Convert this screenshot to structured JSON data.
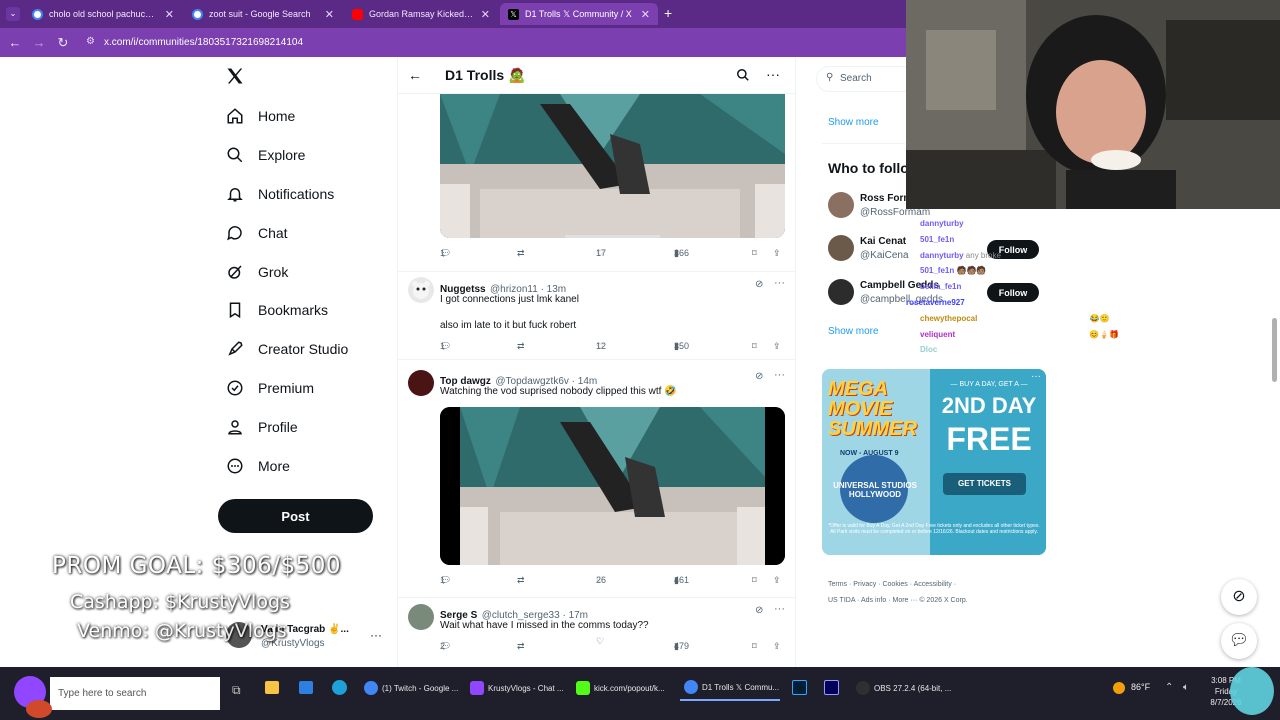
{
  "browser": {
    "tabs": [
      {
        "title": "cholo old school pachuco style",
        "favicon_color": "#4285f4",
        "active": false
      },
      {
        "title": "zoot suit - Google Search",
        "favicon_color": "#4285f4",
        "active": false
      },
      {
        "title": "Gordan Ramsay Kicked Me Out",
        "favicon_color": "#ff0000",
        "active": false
      },
      {
        "title": "D1 Trolls 𝕏 Community / X",
        "favicon_color": "#000000",
        "active": true
      }
    ],
    "url": "x.com/i/communities/1803517321698214104"
  },
  "nav": {
    "items": [
      {
        "label": "Home",
        "icon": "home-icon"
      },
      {
        "label": "Explore",
        "icon": "search-icon"
      },
      {
        "label": "Notifications",
        "icon": "bell-icon"
      },
      {
        "label": "Chat",
        "icon": "chat-icon"
      },
      {
        "label": "Grok",
        "icon": "grok-icon"
      },
      {
        "label": "Bookmarks",
        "icon": "bookmark-icon"
      },
      {
        "label": "Creator Studio",
        "icon": "rocket-icon"
      },
      {
        "label": "Premium",
        "icon": "verified-icon"
      },
      {
        "label": "Profile",
        "icon": "person-icon"
      },
      {
        "label": "More",
        "icon": "more-circle-icon"
      }
    ],
    "post_label": "Post",
    "account_name": "Va in Tacgrab ✌️...",
    "account_handle": "@KrustyVlogs"
  },
  "overlay": {
    "goal": "PROM GOAL: $306/$500",
    "cashapp": "Cashapp: $KrustyVlogs",
    "venmo": "Venmo: @KrustyVlogs"
  },
  "column": {
    "title": "D1 Trolls 🧟",
    "tweets": [
      {
        "replies": "1",
        "likes": "17",
        "views": "366"
      },
      {
        "name": "Nuggetss",
        "handle": "@hrizon11 · 13m",
        "text": "I got connections just lmk kanel",
        "text2": "also im late to it but fuck robert",
        "replies": "1",
        "likes": "12",
        "views": "350"
      },
      {
        "name": "Top dawgz",
        "handle": "@Topdawgztk6v · 14m",
        "text": "Watching the vod suprised nobody clipped this wtf 🤣",
        "replies": "1",
        "likes": "26",
        "views": "461"
      },
      {
        "name": "Serge S",
        "handle": "@clutch_serge33 · 17m",
        "text": "Wait what have I missed in the comms today??",
        "replies": "2",
        "likes": "",
        "views": "479"
      }
    ]
  },
  "right": {
    "search_placeholder": "Search",
    "show_more": "Show more",
    "who_to_follow": "Who to follo",
    "follow": [
      {
        "name": "Ross Forn",
        "handle": "@RossFormam"
      },
      {
        "name": "Kai Cenat",
        "handle": "@KaiCena"
      },
      {
        "name": "Campbell Gedds",
        "handle": "@campbell_gedds"
      }
    ],
    "follow_label": "Follow",
    "show_more2": "Show more",
    "ad": {
      "line1": "MEGA",
      "line2": "MOVIE",
      "line3": "SUMMER",
      "now": "NOW - AUGUST 9",
      "buy": "— BUY A DAY, GET A —",
      "second": "2ND DAY",
      "free": "FREE",
      "cta": "GET TICKETS",
      "brand": "UNIVERSAL STUDIOS HOLLYWOOD",
      "fine": "*Offer is valid for Buy A Day, Get A 2nd Day Free tickets only and excludes all other ticket types. All Park visits must be completed on or before 12/16/26. Blackout dates and restrictions apply."
    },
    "footer": [
      "Terms",
      "Privacy",
      "Cookies",
      "Accessibility",
      "US TIDA",
      "Ads info",
      "More ···",
      "© 2026 X Corp."
    ]
  },
  "chat": [
    {
      "user": "dannyturby",
      "color": "#6f5cf2",
      "msg": "..."
    },
    {
      "user": "501_fe1n",
      "color": "#6f5cf2",
      "msg": "..."
    },
    {
      "user": "dannyturby",
      "color": "#6f5cf2",
      "msg": "any broke"
    },
    {
      "user": "501_fe1n",
      "color": "#6f5cf2",
      "msg": "🧑🏽🧑🏽🧑🏽"
    },
    {
      "user": "bellla_fe1n",
      "color": "#6f5cf2",
      "msg": ""
    },
    {
      "user": "rosetaverne927",
      "color": "#3c3cff",
      "msg": ""
    },
    {
      "user": "chewythepocal",
      "color": "#c28a12",
      "msg": "😂🙂"
    },
    {
      "user": "veliquent",
      "color": "#b02fc9",
      "msg": "😊🍦🎁"
    },
    {
      "user": "Dloc",
      "color": "#2aa198",
      "msg": ""
    }
  ],
  "taskbar": {
    "search_placeholder": "Type here to search",
    "apps": [
      {
        "label": "(1) Twitch - Google ...",
        "color": "#4285f4"
      },
      {
        "label": "KrustyVlogs - Chat ...",
        "color": "#9146ff"
      },
      {
        "label": "kick.com/popout/k...",
        "color": "#53fc18"
      },
      {
        "label": "D1 Trolls 𝕏 Commu...",
        "color": "#4285f4"
      },
      {
        "label": "OBS 27.2.4 (64-bit, ...",
        "color": "#302e31"
      }
    ],
    "weather": "86°F",
    "time": "3:08 PM",
    "day": "Friday",
    "date": "8/7/2026"
  },
  "colors": {
    "brand": "#0f1419",
    "browser": "#7b3fb0",
    "link": "#1d9bf0"
  }
}
